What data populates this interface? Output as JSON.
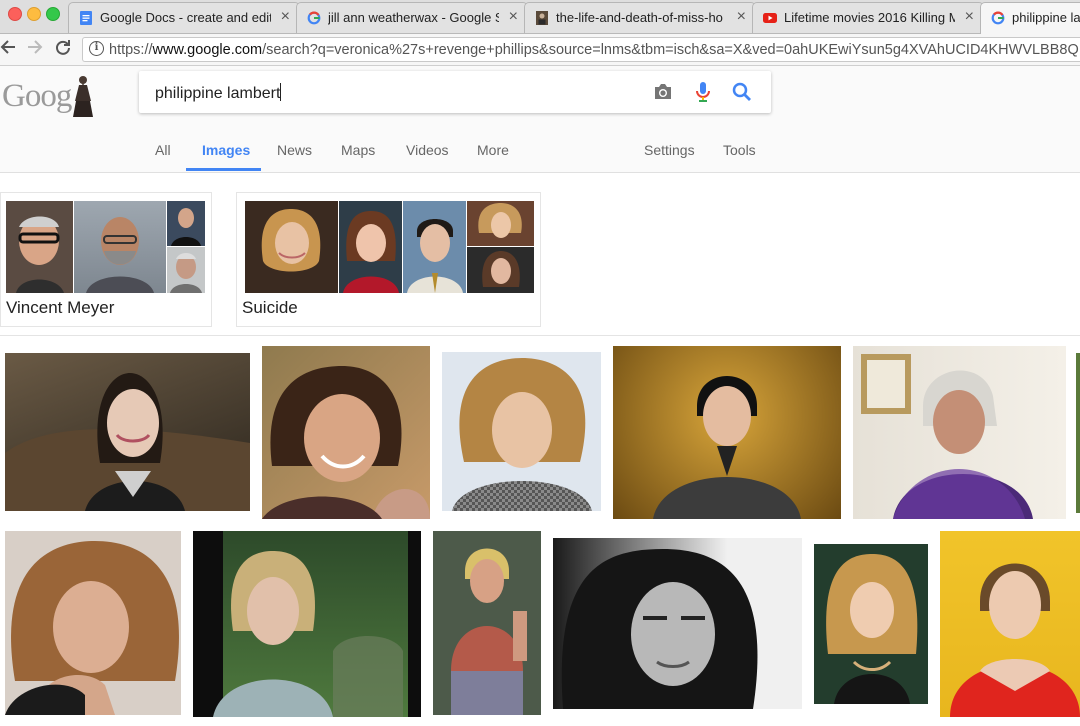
{
  "tabs": [
    {
      "title": "Google Docs - create and edit",
      "favicon": "docs-icon",
      "active": false
    },
    {
      "title": "jill ann weatherwax - Google S",
      "favicon": "google-g-icon",
      "active": false
    },
    {
      "title": "the-life-and-death-of-miss-ho",
      "favicon": "page-thumb-icon",
      "active": false
    },
    {
      "title": "Lifetime movies 2016 Killing M",
      "favicon": "youtube-icon",
      "active": false
    },
    {
      "title": "philippine lar",
      "favicon": "google-g-icon",
      "active": true
    }
  ],
  "address_bar": {
    "url_prefix": "https://",
    "url_host": "www.google.com",
    "url_path": "/search?q=veronica%27s+revenge+phillips&source=lnms&tbm=isch&sa=X&ved=0ahUKEwiYsun5g4XVAhUCID4KHWVLBB8Q"
  },
  "search": {
    "logo_text": "Goog",
    "query": "philippine lambert"
  },
  "nav_tabs": {
    "all": "All",
    "images": "Images",
    "news": "News",
    "maps": "Maps",
    "videos": "Videos",
    "more": "More",
    "settings": "Settings",
    "tools": "Tools"
  },
  "related": [
    {
      "label": "Vincent Meyer"
    },
    {
      "label": "Suicide"
    }
  ],
  "colors": {
    "google_blue": "#4285f4",
    "tab_active": "#f6f6f6"
  }
}
